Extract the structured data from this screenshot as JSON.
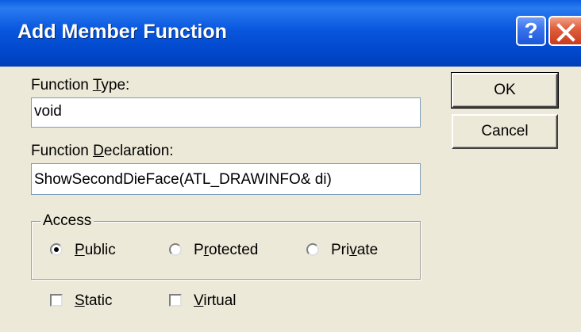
{
  "window": {
    "title": "Add Member Function",
    "help_label": "?"
  },
  "function_type": {
    "label_before": "Function ",
    "label_accel": "T",
    "label_after": "ype:",
    "value": "void"
  },
  "function_declaration": {
    "label_before": "Function ",
    "label_accel": "D",
    "label_after": "eclaration:",
    "value": "ShowSecondDieFace(ATL_DRAWINFO& di)"
  },
  "access": {
    "legend": "Access",
    "selected": "Public",
    "options": [
      {
        "accel": "P",
        "rest": "ublic",
        "before": ""
      },
      {
        "before": "P",
        "accel": "r",
        "rest": "otected"
      },
      {
        "before": "Pri",
        "accel": "v",
        "rest": "ate"
      }
    ]
  },
  "modifiers": {
    "static": {
      "accel": "S",
      "rest": "tatic",
      "checked": false
    },
    "virtual": {
      "accel": "V",
      "rest": "irtual",
      "checked": false
    }
  },
  "buttons": {
    "ok_label": "OK",
    "cancel_label": "Cancel"
  }
}
